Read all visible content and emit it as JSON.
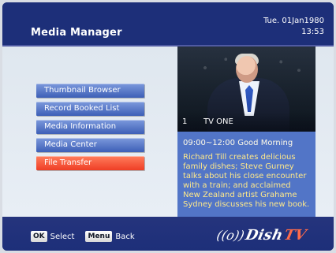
{
  "header": {
    "title": "Media Manager",
    "date": "Tue. 01Jan1980",
    "time": "13:53"
  },
  "menu": {
    "items": [
      {
        "label": "Thumbnail Browser",
        "active": false
      },
      {
        "label": "Record Booked List",
        "active": false
      },
      {
        "label": "Media Information",
        "active": false
      },
      {
        "label": "Media Center",
        "active": false
      },
      {
        "label": "File Transfer",
        "active": true
      }
    ]
  },
  "preview": {
    "channel_number": "1",
    "channel_name": "TV ONE",
    "program": "09:00~12:00  Good Morning",
    "description": "Richard Till creates delicious family dishes; Steve Gurney talks about his close encounter with a train; and acclaimed New Zealand artist Grahame Sydney discusses his new book."
  },
  "footer": {
    "ok_key": "OK",
    "ok_label": "Select",
    "menu_key": "Menu",
    "menu_label": "Back"
  },
  "brand": {
    "logo_mark": "((o))",
    "logo_word": "Dish",
    "logo_tv": "TV"
  },
  "colors": {
    "header_blue": "#1d2f79",
    "menu_blue": "#4f71c8",
    "active_orange": "#ef3e25",
    "info_blue": "#5275c7",
    "description_text": "#ffe98a"
  }
}
